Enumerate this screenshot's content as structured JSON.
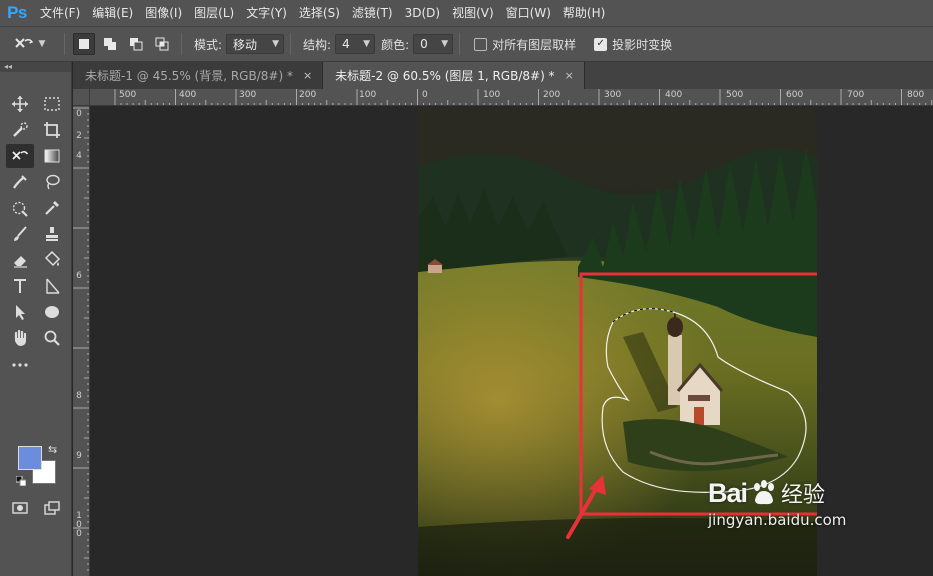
{
  "app": {
    "logo": "Ps"
  },
  "menu": [
    "文件(F)",
    "编辑(E)",
    "图像(I)",
    "图层(L)",
    "文字(Y)",
    "选择(S)",
    "滤镜(T)",
    "3D(D)",
    "视图(V)",
    "窗口(W)",
    "帮助(H)"
  ],
  "options": {
    "tool_icon": "content-aware-move-icon",
    "mode_label": "模式:",
    "mode_value": "移动",
    "structure_label": "结构:",
    "structure_value": "4",
    "color_label": "颜色:",
    "color_value": "0",
    "sample_all_layers": "对所有图层取样",
    "sample_all_layers_checked": false,
    "transform_on_drop": "投影时变换",
    "transform_on_drop_checked": true
  },
  "tabs": [
    {
      "label": "未标题-1 @ 45.5% (背景, RGB/8#) *",
      "close": "×",
      "active": false
    },
    {
      "label": "未标题-2 @ 60.5% (图层 1, RGB/8#) *",
      "close": "×",
      "active": true
    }
  ],
  "ruler_h": [
    "500",
    "400",
    "300",
    "200",
    "100",
    "0",
    "100",
    "200",
    "300",
    "400",
    "500",
    "600",
    "700",
    "800"
  ],
  "ruler_v": [
    "0",
    "2",
    "4",
    "6",
    "8",
    "9",
    "1 0 0"
  ],
  "colors": {
    "foreground": "#6b8ddb",
    "background": "#ffffff",
    "accent": "#31a8ff",
    "selection_box": "#e8323a"
  },
  "toolbox_collapse": "◂◂",
  "watermark": {
    "logo_text": "Bai",
    "logo_suffix": "经验",
    "url": "jingyan.baidu.com"
  }
}
